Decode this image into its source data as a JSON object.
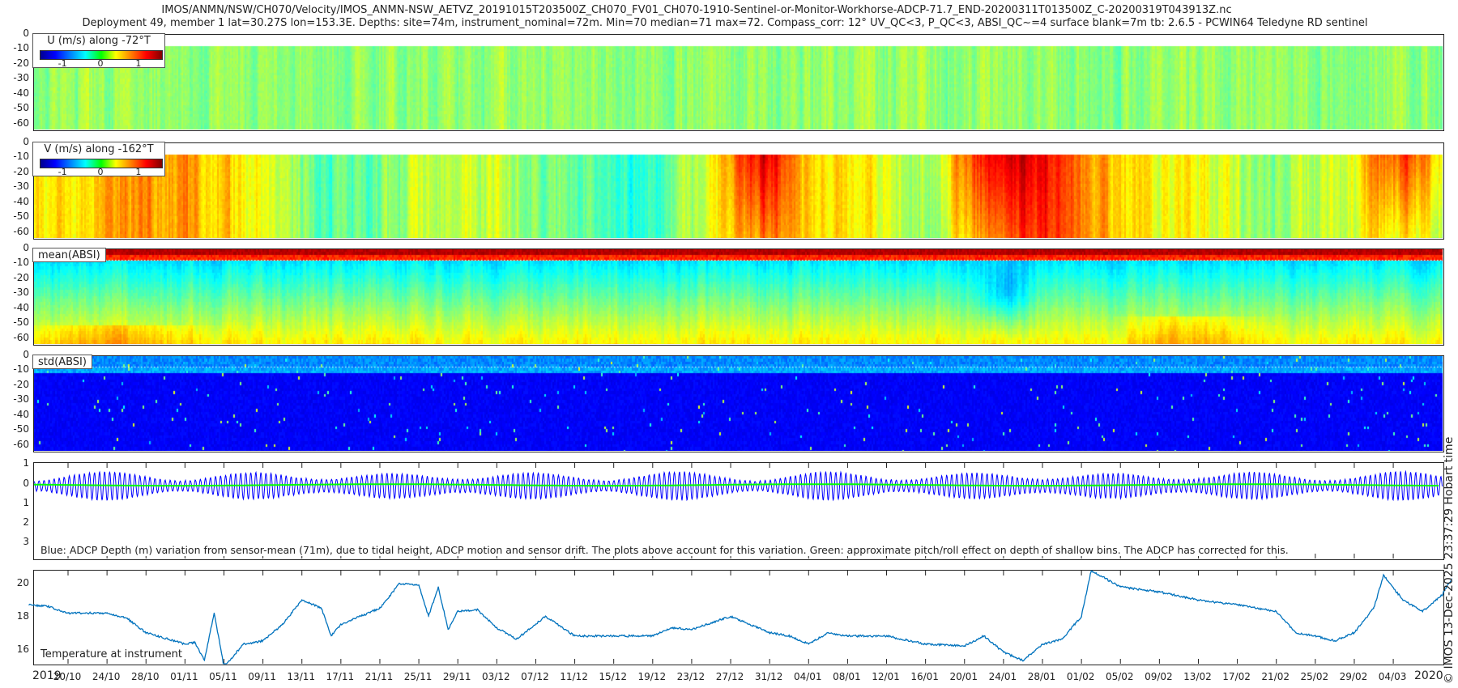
{
  "title": {
    "line1": "IMOS/ANMN/NSW/CH070/Velocity/IMOS_ANMN-NSW_AETVZ_20191015T203500Z_CH070_FV01_CH070-1910-Sentinel-or-Monitor-Workhorse-ADCP-71.7_END-20200311T013500Z_C-20200319T043913Z.nc",
    "line2": "Deployment 49, member 1 lat=30.27S lon=153.3E. Depths: site=74m, instrument_nominal=72m. Min=70 median=71 max=72. Compass_corr: 12° UV_QC<3, P_QC<3, ABSI_QC~=4 surface blank=7m tb: 2.6.5 - PCWIN64 Teledyne RD sentinel"
  },
  "stamp": "© IMOS 13-Dec-2025 23:37:29 Hobart time",
  "colormap": "jet",
  "chart_data": [
    {
      "type": "heatmap",
      "id": "u",
      "legend": "U (m/s) along -72°T",
      "colorbar_ticks": [
        "-1",
        "0",
        "1"
      ],
      "clim": [
        -1.6,
        1.6
      ],
      "ylim": [
        -65,
        0
      ],
      "yticks": [
        "0",
        "-10",
        "-20",
        "-30",
        "-40",
        "-50",
        "-60"
      ],
      "surface_blank_m": 7
    },
    {
      "type": "heatmap",
      "id": "v",
      "legend": "V (m/s) along -162°T",
      "colorbar_ticks": [
        "-1",
        "0",
        "1"
      ],
      "clim": [
        -1.6,
        1.6
      ],
      "ylim": [
        -65,
        0
      ],
      "yticks": [
        "0",
        "-10",
        "-20",
        "-30",
        "-40",
        "-50",
        "-60"
      ],
      "surface_blank_m": 7
    },
    {
      "type": "heatmap",
      "id": "mean",
      "legend": "mean(ABSI)",
      "ylim": [
        -65,
        0
      ],
      "yticks": [
        "0",
        "-10",
        "-20",
        "-30",
        "-40",
        "-50",
        "-60"
      ]
    },
    {
      "type": "heatmap",
      "id": "std",
      "legend": "std(ABSI)",
      "ylim": [
        -65,
        0
      ],
      "yticks": [
        "0",
        "-10",
        "-20",
        "-30",
        "-40",
        "-50",
        "-60"
      ]
    },
    {
      "type": "line",
      "id": "depth",
      "ylim": [
        -1.1,
        3.9
      ],
      "reversed": true,
      "yticks": [
        "1",
        "0",
        "1",
        "2",
        "3"
      ],
      "series": [
        {
          "color": "#0000ff"
        },
        {
          "color": "#00ff00"
        }
      ],
      "annotation": "Blue: ADCP Depth (m) variation from sensor-mean (71m), due to tidal height, ADCP motion and sensor drift. The plots above account for this variation. Green: approximate pitch/roll effect on depth of shallow bins. The ADCP has corrected for this."
    },
    {
      "type": "line",
      "id": "temperature",
      "annotation": "Temperature at instrument",
      "ylim": [
        15.1,
        20.8
      ],
      "yticks": [
        "20",
        "18",
        "16"
      ],
      "color": "#0072bd",
      "x": [
        "2019-10-16",
        "2019-10-18",
        "2019-10-20",
        "2019-10-24",
        "2019-10-26",
        "2019-10-28",
        "2019-11-01",
        "2019-11-02",
        "2019-11-03",
        "2019-11-04",
        "2019-11-05",
        "2019-11-07",
        "2019-11-09",
        "2019-11-11",
        "2019-11-13",
        "2019-11-15",
        "2019-11-16",
        "2019-11-17",
        "2019-11-21",
        "2019-11-23",
        "2019-11-25",
        "2019-11-26",
        "2019-11-27",
        "2019-11-28",
        "2019-11-29",
        "2019-12-01",
        "2019-12-03",
        "2019-12-05",
        "2019-12-08",
        "2019-12-11",
        "2019-12-15",
        "2019-12-19",
        "2019-12-21",
        "2019-12-23",
        "2019-12-27",
        "2019-12-29",
        "2019-12-31",
        "2020-01-02",
        "2020-01-04",
        "2020-01-06",
        "2020-01-08",
        "2020-01-12",
        "2020-01-16",
        "2020-01-20",
        "2020-01-22",
        "2020-01-24",
        "2020-01-26",
        "2020-01-28",
        "2020-01-30",
        "2020-02-01",
        "2020-02-02",
        "2020-02-05",
        "2020-02-09",
        "2020-02-13",
        "2020-02-17",
        "2020-02-21",
        "2020-02-23",
        "2020-02-25",
        "2020-02-27",
        "2020-02-29",
        "2020-03-02",
        "2020-03-03",
        "2020-03-05",
        "2020-03-07",
        "2020-03-09",
        "2020-03-10"
      ],
      "y": [
        18.7,
        18.6,
        18.2,
        18.2,
        17.9,
        17.0,
        16.3,
        16.4,
        15.3,
        18.2,
        14.9,
        16.3,
        16.5,
        17.5,
        19.0,
        18.5,
        16.8,
        17.5,
        18.5,
        20.0,
        19.9,
        18.0,
        19.8,
        17.2,
        18.3,
        18.4,
        17.3,
        16.6,
        18.0,
        16.8,
        16.8,
        16.8,
        17.3,
        17.2,
        18.0,
        17.5,
        17.0,
        16.8,
        16.3,
        17.0,
        16.8,
        16.8,
        16.3,
        16.2,
        16.8,
        15.8,
        15.3,
        16.3,
        16.6,
        18.0,
        20.8,
        19.8,
        19.5,
        19.0,
        18.7,
        18.3,
        17.0,
        16.8,
        16.5,
        17.0,
        18.5,
        20.5,
        19.0,
        18.3,
        19.3,
        20.3
      ]
    }
  ],
  "xaxis": {
    "ticks": [
      "20/10",
      "24/10",
      "28/10",
      "01/11",
      "05/11",
      "09/11",
      "13/11",
      "17/11",
      "21/11",
      "25/11",
      "29/11",
      "03/12",
      "07/12",
      "11/12",
      "15/12",
      "19/12",
      "23/12",
      "27/12",
      "31/12",
      "04/01",
      "08/01",
      "12/01",
      "16/01",
      "20/01",
      "24/01",
      "28/01",
      "01/02",
      "05/02",
      "09/02",
      "13/02",
      "17/02",
      "21/02",
      "25/02",
      "29/02",
      "04/03"
    ],
    "year_start": "2019",
    "year_end": "2020"
  }
}
